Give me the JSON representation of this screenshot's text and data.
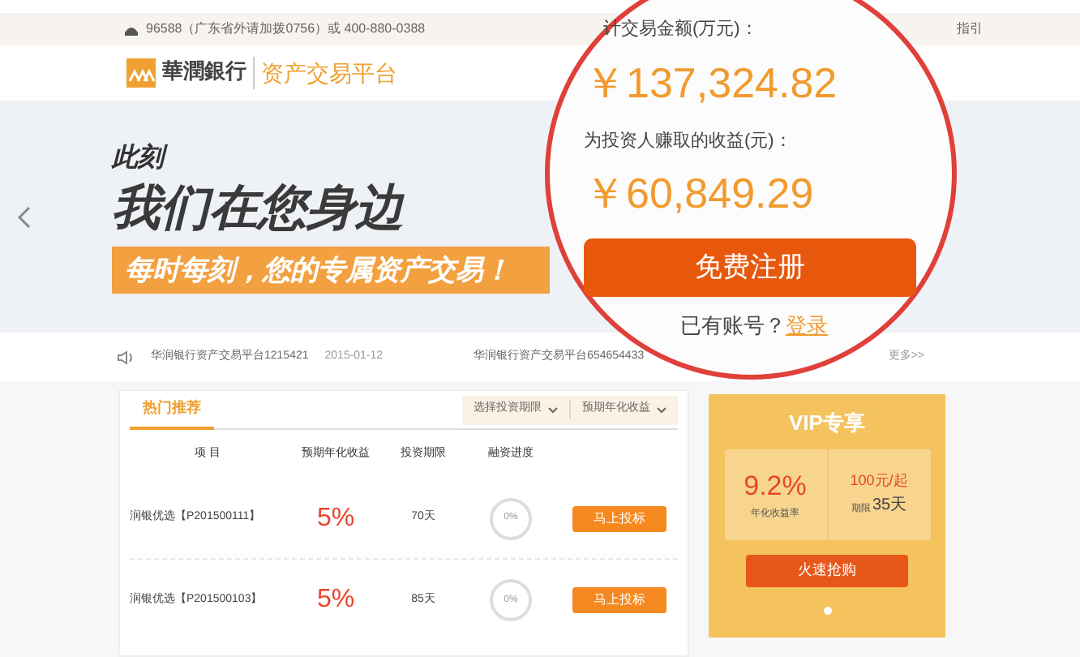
{
  "top_bar": {
    "phone": "96588（广东省外请加拨0756）或 400-880-0388",
    "link": "指引"
  },
  "header": {
    "bank_name": "華潤銀行",
    "platform": "资产交易平台"
  },
  "banner": {
    "line_1": "此刻",
    "line_2": "我们在您身边",
    "line_3": "每时每刻，您的专属资产交易！"
  },
  "stats": {
    "total_label": "计交易金额(万元)：",
    "total": "￥137,324.82",
    "earnings_label": "为投资人赚取的收益(元)：",
    "earnings": "￥60,849.29",
    "register_button": "免费注册",
    "login_prompt": "已有账号？",
    "login_link": "登录"
  },
  "notices": [
    {
      "title": "华润银行资产交易平台1215421",
      "date": "2015-01-12"
    },
    {
      "title": "华润银行资产交易平台654654433"
    }
  ],
  "more": "更多>>",
  "products": {
    "tab": "热门推荐",
    "filters": [
      "选择投资期限",
      "预期年化收益"
    ],
    "columns": [
      "项 目",
      "预期年化收益",
      "投资期限",
      "融资进度"
    ],
    "rows": [
      {
        "name": "润银优选【P201500111】",
        "rate": "5%",
        "term": "70天",
        "progress": "0%",
        "button": "马上投标"
      },
      {
        "name": "润银优选【P201500103】",
        "rate": "5%",
        "term": "85天",
        "progress": "0%",
        "button": "马上投标"
      }
    ]
  },
  "vip": {
    "title": "VIP专享",
    "rate": "9.2%",
    "rate_label": "年化收益率",
    "min": "100元/起",
    "term_label": "期限",
    "term": "35天",
    "button": "火速抢购"
  }
}
